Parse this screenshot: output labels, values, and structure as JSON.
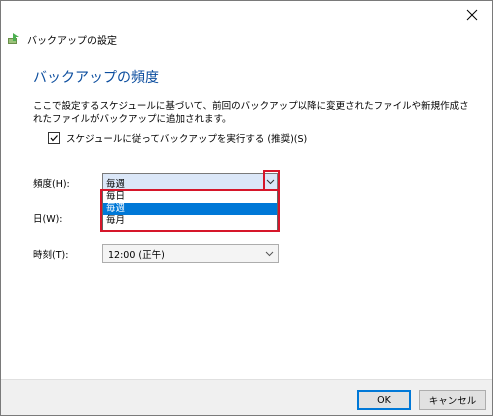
{
  "window": {
    "title": "バックアップの設定",
    "close_icon": "close-icon",
    "app_icon": "backup-icon"
  },
  "main": {
    "heading": "バックアップの頻度",
    "description": "ここで設定するスケジュールに基づいて、前回のバックアップ以降に変更されたファイルや新規作成されたファイルがバックアップに追加されます。",
    "schedule_checkbox": {
      "label": "スケジュールに従ってバックアップを実行する (推奨)(S)",
      "checked": true
    },
    "frequency": {
      "label": "頻度(H):",
      "value": "毎週",
      "options": [
        "毎日",
        "毎週",
        "毎月"
      ],
      "selected_index": 1
    },
    "day": {
      "label": "日(W):"
    },
    "time": {
      "label": "時刻(T):",
      "value": "12:00 (正午)"
    }
  },
  "footer": {
    "ok_label": "OK",
    "cancel_label": "キャンセル"
  },
  "colors": {
    "heading": "#0b4d9e",
    "highlight": "#0078d7",
    "annotation_red": "#d6162a"
  }
}
